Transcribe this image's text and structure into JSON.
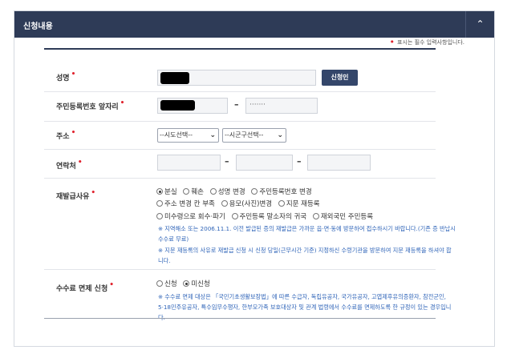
{
  "header": {
    "title": "신청내용",
    "toggle_icon": "chevron-up-icon",
    "toggle_glyph": "⌃"
  },
  "note": {
    "dot": "•",
    "text": "표시는 필수 입력사항입니다."
  },
  "rows": {
    "name": {
      "label": "성명",
      "button_label": "신청인"
    },
    "rrn": {
      "label": "주민등록번호 앞자리",
      "dash": "–",
      "masked_back": "·······"
    },
    "address": {
      "label": "주소",
      "sido_selected": "--시도선택--",
      "sigungu_selected": "--시군구선택--"
    },
    "phone": {
      "label": "연락처",
      "dash1": "–",
      "dash2": "–"
    },
    "reason": {
      "label": "재발급사유",
      "options": [
        "분실",
        "훼손",
        "성명 변경",
        "주민등록번호 변경",
        "주소 변경 칸 부족",
        "용모(사진)변경",
        "지문 재등록",
        "미수령으로 회수·파기",
        "주민등록 말소자의 귀국",
        "재외국민 주민등록"
      ],
      "selected_index": 0,
      "info1": "※ 지역해소 또는 2006.11.1. 이전 발급된 증의 재발급은 가까운 읍·면·동에 방문하여 접수하시기 바랍니다.(기존 증 반납시 수수료 무료)",
      "info2": "※ 지문 재등록의 사유로 재발급 신청 시 신청 당일(근무시간 기준) 지정하신 수령기관을 방문하여 지문 재등록을 하셔야 합니다."
    },
    "fee": {
      "label": "수수료 면제 신청",
      "options": [
        "신청",
        "미신청"
      ],
      "selected_index": 1,
      "info": "※ 수수료 면제 대상은 「국민기초생활보장법」에 따른 수급자, 독립유공자, 국가유공자, 고엽제후유의증환자, 참전군인, 5·18민주유공자, 특수임무수행자, 한부모가족 보호대상자 및 관계 법령에서 수수료를 면제하도록 한 규정이 있는 경우입니다."
    },
    "required_mark": "•"
  }
}
